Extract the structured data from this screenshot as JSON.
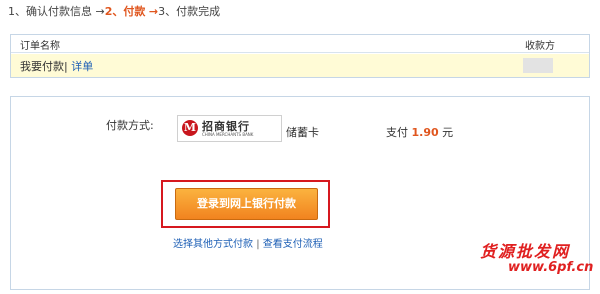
{
  "steps": {
    "step1": "1、确认付款信息",
    "arrow1": "→",
    "step2": "2、付款",
    "arrow2": "→",
    "step3": "3、付款完成"
  },
  "order": {
    "header_name": "订单名称",
    "header_payee": "收款方",
    "name": "我要付款",
    "separator": "|",
    "details_link": "详单"
  },
  "payment": {
    "method_label": "付款方式:",
    "bank_name": "招商银行",
    "bank_en": "CHINA MERCHANTS BANK",
    "card_type": "储蓄卡",
    "pay_label": "支付",
    "amount": "1.90",
    "currency": "元",
    "login_button": "登录到网上银行付款",
    "other_link": "选择其他方式付款",
    "link_sep": "|",
    "flow_link": "查看支付流程"
  },
  "watermark": {
    "line1": "货源批发网",
    "line2": "www.6pf.cn"
  },
  "colors": {
    "accent": "#e0561e",
    "link": "#1d5fb5",
    "highlight_border": "#d6181f",
    "order_row_bg": "#fffbd6"
  }
}
